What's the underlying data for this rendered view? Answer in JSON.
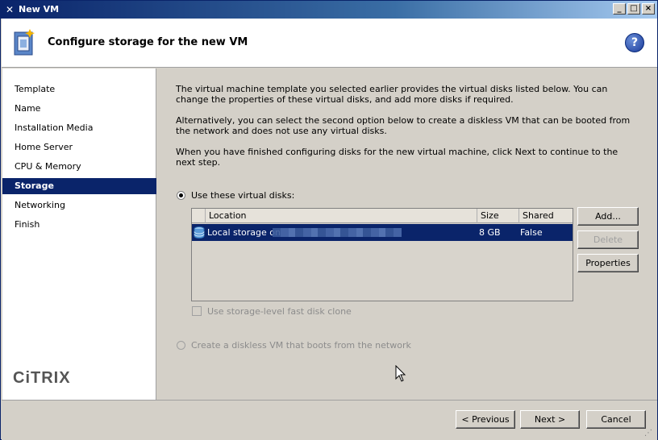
{
  "window": {
    "title": "New VM"
  },
  "header": {
    "title": "Configure storage for the new VM",
    "help_icon": "?"
  },
  "sidebar": {
    "steps": [
      {
        "label": "Template"
      },
      {
        "label": "Name"
      },
      {
        "label": "Installation Media"
      },
      {
        "label": "Home Server"
      },
      {
        "label": "CPU & Memory"
      },
      {
        "label": "Storage",
        "active": true
      },
      {
        "label": "Networking"
      },
      {
        "label": "Finish"
      }
    ],
    "logo": "CiTRIX"
  },
  "main": {
    "intro_1": "The virtual machine template you selected earlier provides the virtual disks listed below. You can change the properties of these virtual disks, and add more disks if required.",
    "intro_2": "Alternatively, you can select the second option below to create a diskless VM that can be booted from the network and does not use any virtual disks.",
    "intro_3": "When you have finished configuring disks for the new virtual machine, click Next to continue to the next step.",
    "option_disks": "Use these virtual disks:",
    "table": {
      "columns": [
        "Location",
        "Size",
        "Shared"
      ],
      "rows": [
        {
          "location": "Local storage on",
          "size": "8 GB",
          "shared": "False"
        }
      ]
    },
    "buttons": {
      "add": "Add...",
      "delete": "Delete",
      "properties": "Properties"
    },
    "fast_clone": "Use storage-level fast disk clone",
    "option_diskless": "Create a diskless VM that boots from the network"
  },
  "footer": {
    "previous": "< Previous",
    "next": "Next >",
    "cancel": "Cancel"
  },
  "colors": {
    "titlebar": "#0a246a",
    "selection": "#0a246a",
    "face": "#d4d0c8"
  }
}
